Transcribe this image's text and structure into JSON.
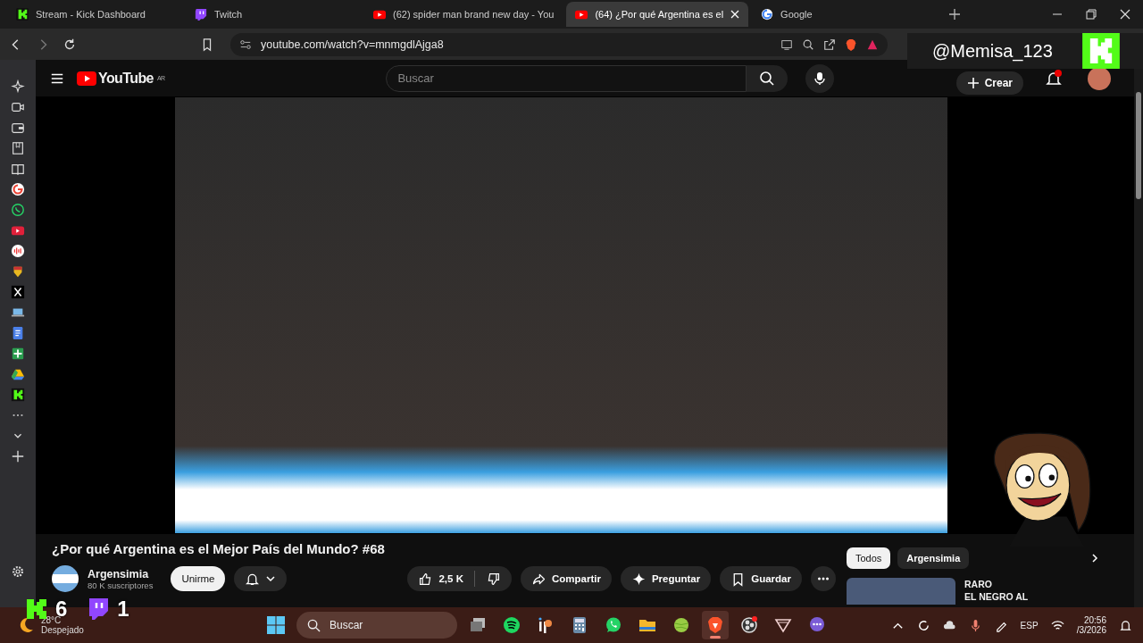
{
  "browser": {
    "tabs": [
      {
        "kind": "kick",
        "title": "Stream - Kick Dashboard",
        "selected": false
      },
      {
        "kind": "twitch",
        "title": "Twitch",
        "selected": false
      },
      {
        "kind": "youtube",
        "title": "(62) spider man brand new day - You",
        "selected": false
      },
      {
        "kind": "youtube",
        "title": "(64) ¿Por qué Argentina es el",
        "selected": true
      },
      {
        "kind": "google",
        "title": "Google",
        "selected": false
      }
    ],
    "url": "youtube.com/watch?v=mnmgdlAjga8"
  },
  "youtube": {
    "logo": "YouTube",
    "region": "AR",
    "search": {
      "placeholder": "Buscar"
    },
    "create_label": "Crear",
    "video": {
      "title": "¿Por qué Argentina es el Mejor País del Mundo? #68",
      "channel": "Argensimia",
      "subscribers": "80 K suscriptores",
      "join_label": "Unirme",
      "likes": "2,5 K",
      "actions": [
        {
          "kind": "share",
          "label": "Compartir"
        },
        {
          "kind": "ask",
          "label": "Preguntar"
        },
        {
          "kind": "save",
          "label": "Guardar"
        }
      ]
    },
    "chips": [
      {
        "label": "Todos",
        "selected": true
      },
      {
        "label": "Argensimia",
        "selected": false
      }
    ],
    "recommended": {
      "line_1": "RARO",
      "line_2": "EL NEGRO AL"
    }
  },
  "stream_overlay": {
    "handle": "@Memisa_123",
    "kick_viewers": "6",
    "twitch_viewers": "1"
  },
  "taskbar": {
    "weather": {
      "temp": "28°C",
      "condition": "Despejado"
    },
    "search": {
      "placeholder": "Buscar"
    },
    "apps": [
      {
        "kind": "taskview",
        "active": false
      },
      {
        "kind": "spotify",
        "active": false
      },
      {
        "kind": "ip",
        "active": false
      },
      {
        "kind": "calculator",
        "active": false
      },
      {
        "kind": "whatsapp",
        "active": false
      },
      {
        "kind": "folder",
        "active": false
      },
      {
        "kind": "ball",
        "active": false
      },
      {
        "kind": "brave",
        "active": true
      },
      {
        "kind": "obs",
        "active": false
      },
      {
        "kind": "triangle",
        "active": false
      },
      {
        "kind": "chat",
        "active": false
      }
    ],
    "language": "ESP",
    "time": "20:56",
    "date": "/3/2026"
  }
}
